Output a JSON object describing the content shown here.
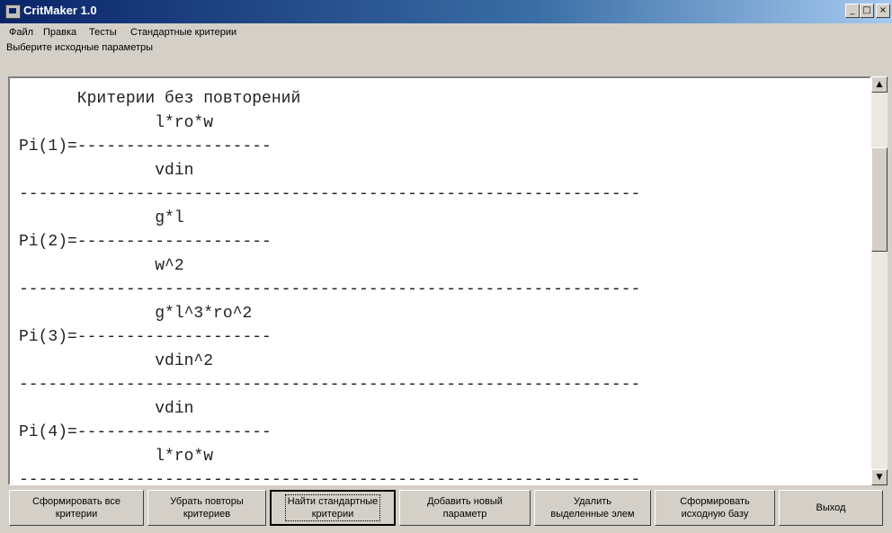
{
  "window": {
    "title": "CritMaker 1.0",
    "controls": {
      "minimize": "_",
      "maximize": "□",
      "close": "×"
    }
  },
  "menu": [
    {
      "label": "Файл"
    },
    {
      "label": "Правка"
    },
    {
      "label": "Тесты"
    },
    {
      "label": "Стандартные критерии"
    }
  ],
  "prompt": "Выберите исходные параметры",
  "output": {
    "lines": [
      "      Критерии без повторений",
      "              l*ro*w",
      "Pi(1)=--------------------",
      "              vdin",
      "----------------------------------------------------------------",
      "              g*l",
      "Pi(2)=--------------------",
      "              w^2",
      "----------------------------------------------------------------",
      "              g*l^3*ro^2",
      "Pi(3)=--------------------",
      "              vdin^2",
      "----------------------------------------------------------------",
      "              vdin",
      "Pi(4)=--------------------",
      "              l*ro*w",
      "----------------------------------------------------------------"
    ]
  },
  "scrollbar": {
    "up_icon": "▲",
    "down_icon": "▼",
    "position": 0.2
  },
  "buttons": [
    {
      "label": "Сформировать все\nкритерии"
    },
    {
      "label": "Убрать повторы\nкритериев"
    },
    {
      "label": "Найти стандартные\nкритерии"
    },
    {
      "label": "Добавить новый\nпараметр"
    },
    {
      "label": "Удалить\nвыделенные элем"
    },
    {
      "label": "Сформировать\nисходную базу"
    },
    {
      "label": "Выход"
    }
  ]
}
